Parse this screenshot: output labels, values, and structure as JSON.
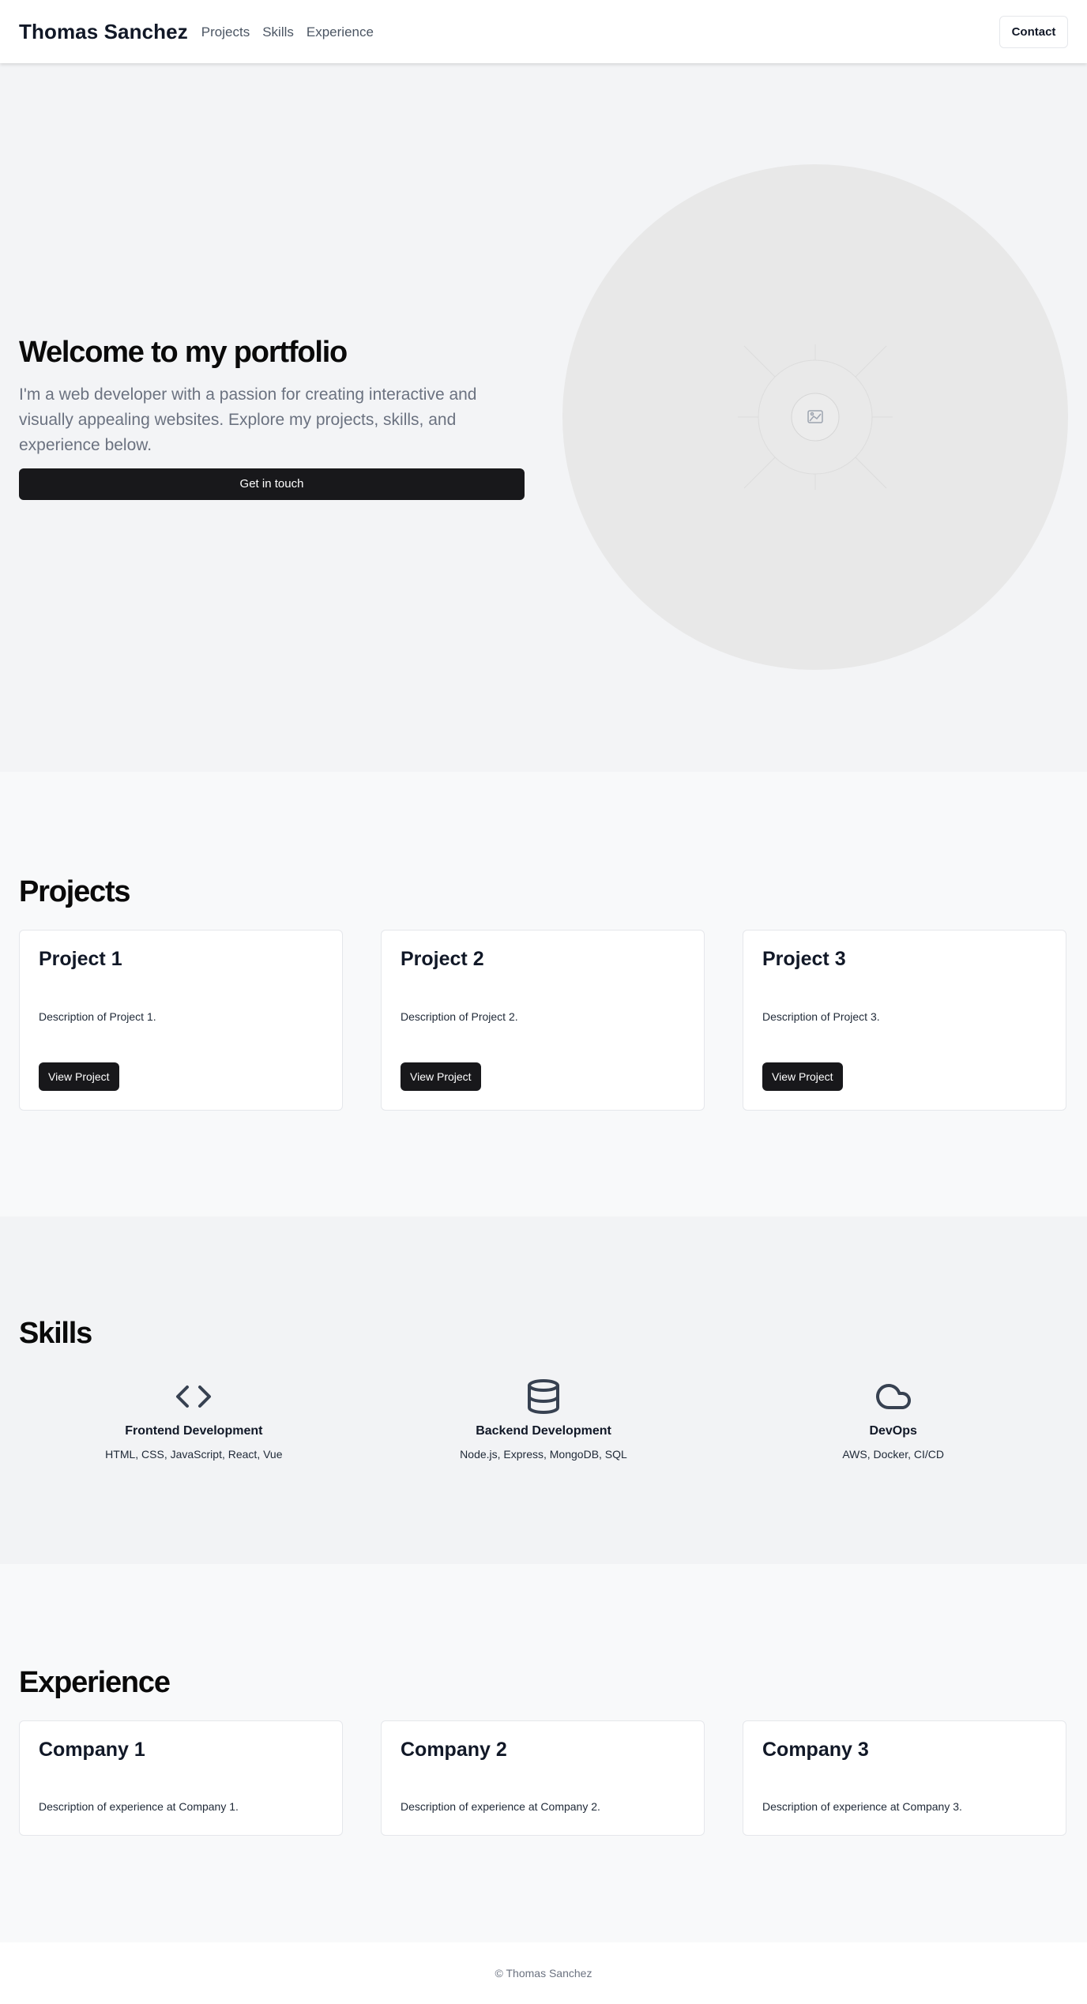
{
  "header": {
    "brand": "Thomas Sanchez",
    "nav": [
      "Projects",
      "Skills",
      "Experience"
    ],
    "contact_label": "Contact"
  },
  "hero": {
    "title": "Welcome to my portfolio",
    "text": "I'm a web developer with a passion for creating interactive and visually appealing websites. Explore my projects, skills, and experience below.",
    "cta_label": "Get in touch",
    "image_icon": "image-placeholder-icon"
  },
  "projects": {
    "title": "Projects",
    "items": [
      {
        "title": "Project 1",
        "desc": "Description of Project 1.",
        "button": "View Project"
      },
      {
        "title": "Project 2",
        "desc": "Description of Project 2.",
        "button": "View Project"
      },
      {
        "title": "Project 3",
        "desc": "Description of Project 3.",
        "button": "View Project"
      }
    ]
  },
  "skills": {
    "title": "Skills",
    "items": [
      {
        "icon": "code-icon",
        "title": "Frontend Development",
        "desc": "HTML, CSS, JavaScript, React, Vue"
      },
      {
        "icon": "database-icon",
        "title": "Backend Development",
        "desc": "Node.js, Express, MongoDB, SQL"
      },
      {
        "icon": "cloud-icon",
        "title": "DevOps",
        "desc": "AWS, Docker, CI/CD"
      }
    ]
  },
  "experience": {
    "title": "Experience",
    "items": [
      {
        "title": "Company 1",
        "desc": "Description of experience at Company 1."
      },
      {
        "title": "Company 2",
        "desc": "Description of experience at Company 2."
      },
      {
        "title": "Company 3",
        "desc": "Description of experience at Company 3."
      }
    ]
  },
  "footer": {
    "text": "© Thomas Sanchez"
  },
  "colors": {
    "primary_button": "#18181b",
    "muted_text": "#6b7280",
    "hero_bg": "#f3f4f6",
    "icon_stroke": "#374151"
  }
}
